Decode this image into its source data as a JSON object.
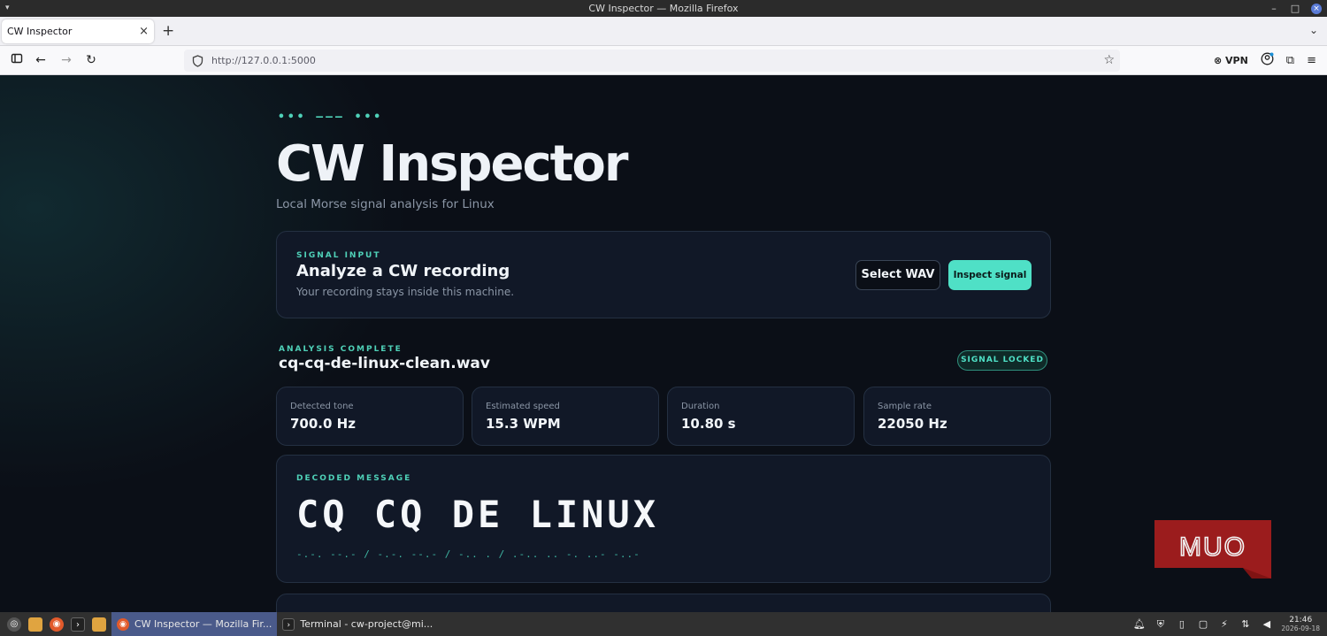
{
  "window": {
    "title": "CW Inspector — Mozilla Firefox"
  },
  "browser": {
    "tab_title": "CW Inspector",
    "url": "http://127.0.0.1:5000",
    "vpn_label": "VPN"
  },
  "header": {
    "morse_decoration": "••• ––– •••",
    "title": "CW Inspector",
    "subtitle": "Local Morse signal analysis for Linux"
  },
  "signal_input": {
    "eyebrow": "SIGNAL INPUT",
    "title": "Analyze a CW recording",
    "subtitle": "Your recording stays inside this machine.",
    "select_button": "Select WAV",
    "inspect_button": "Inspect signal"
  },
  "result": {
    "eyebrow": "ANALYSIS COMPLETE",
    "filename": "cq-cq-de-linux-clean.wav",
    "status": "SIGNAL LOCKED",
    "stats": [
      {
        "label": "Detected tone",
        "value": "700.0 Hz"
      },
      {
        "label": "Estimated speed",
        "value": "15.3 WPM"
      },
      {
        "label": "Duration",
        "value": "10.80 s"
      },
      {
        "label": "Sample rate",
        "value": "22050 Hz"
      }
    ],
    "decoded_eyebrow": "DECODED MESSAGE",
    "decoded_text": "CQ CQ DE LINUX",
    "decoded_morse": "-.-. --.- / -.-. --.- / -.. . / .-.. .. -. ..- -..-"
  },
  "watermark": {
    "text": "MUO"
  },
  "taskbar": {
    "tasks": [
      {
        "label": "CW Inspector — Mozilla Fir...",
        "active": true
      },
      {
        "label": "Terminal - cw-project@mi...",
        "active": false
      }
    ],
    "time": "21:46",
    "date": "2026-09-18"
  },
  "colors": {
    "accent": "#4fe0c6",
    "background": "#0b0f17",
    "card": "#111827",
    "watermark": "#b51f1f"
  }
}
